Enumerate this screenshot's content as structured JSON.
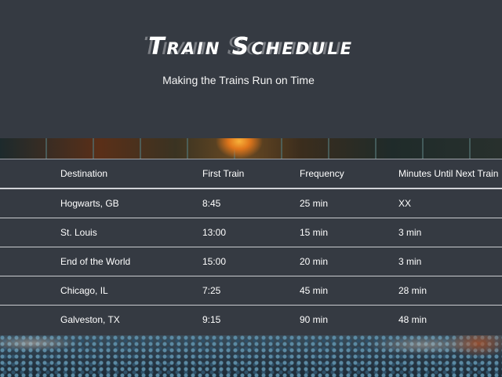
{
  "header": {
    "title": "Train Schedule",
    "subtitle": "Making the Trains Run on Time"
  },
  "table": {
    "columns": [
      "Destination",
      "First Train",
      "Frequency",
      "Minutes Until Next Train"
    ],
    "rows": [
      [
        "Hogwarts, GB",
        "8:45",
        "25 min",
        "XX"
      ],
      [
        "St. Louis",
        "13:00",
        "15 min",
        "3 min"
      ],
      [
        "End of the World",
        "15:00",
        "20 min",
        "3 min"
      ],
      [
        "Chicago, IL",
        "7:25",
        "45 min",
        "28 min"
      ],
      [
        "Galveston, TX",
        "9:15",
        "90 min",
        "48 min"
      ]
    ]
  },
  "colors": {
    "background": "#353a42",
    "text": "#ffffff",
    "row_border": "#c9cbcf"
  }
}
